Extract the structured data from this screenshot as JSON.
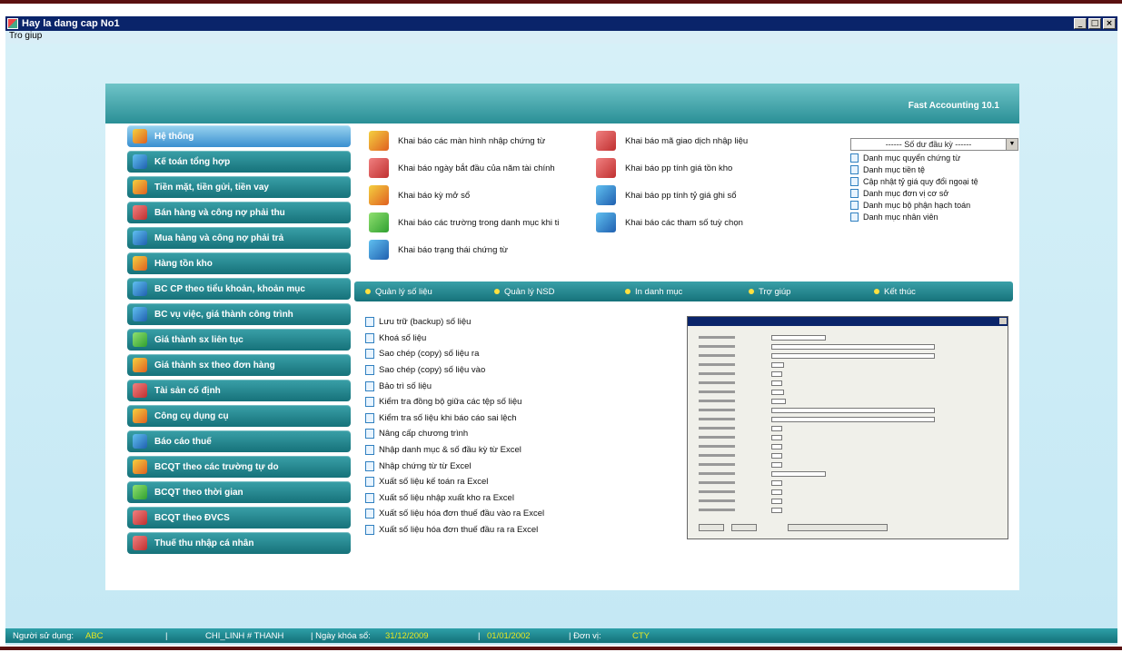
{
  "window": {
    "title": "Hay la dang cap No1",
    "menu": [
      "Tro giup"
    ],
    "controls": [
      "minimize",
      "maximize",
      "close"
    ]
  },
  "header": {
    "product": "Fast Accounting 10.1"
  },
  "nav": {
    "items": [
      {
        "label": "Hệ thống",
        "icon": "gear-icon",
        "active": true
      },
      {
        "label": "Kế toán tổng hợp",
        "icon": "ledger-icon"
      },
      {
        "label": "Tiền mặt, tiền gửi, tiền vay",
        "icon": "cash-icon"
      },
      {
        "label": "Bán hàng và công nợ phải thu",
        "icon": "sales-icon"
      },
      {
        "label": "Mua hàng và công nợ phải trả",
        "icon": "purchase-icon"
      },
      {
        "label": "Hàng tồn kho",
        "icon": "inventory-icon"
      },
      {
        "label": "BC CP theo tiểu khoản, khoản mục",
        "icon": "report-icon"
      },
      {
        "label": "BC vụ việc, giá thành công trình",
        "icon": "project-icon"
      },
      {
        "label": "Giá thành sx liên tục",
        "icon": "cost-icon"
      },
      {
        "label": "Giá thành sx theo đơn hàng",
        "icon": "order-cost-icon"
      },
      {
        "label": "Tài sản cố định",
        "icon": "asset-icon"
      },
      {
        "label": "Công cụ dụng cụ",
        "icon": "tools-icon"
      },
      {
        "label": "Báo cáo thuế",
        "icon": "tax-icon"
      },
      {
        "label": "BCQT theo các trường tự do",
        "icon": "custom-report-icon"
      },
      {
        "label": "BCQT theo thời gian",
        "icon": "time-report-icon"
      },
      {
        "label": "BCQT theo ĐVCS",
        "icon": "unit-report-icon"
      },
      {
        "label": "Thuế thu nhập cá nhân",
        "icon": "person-tax-icon"
      }
    ]
  },
  "functions": [
    {
      "label": "Khai báo các màn hình nhập chứng từ",
      "icon": "edit-form-icon"
    },
    {
      "label": "Khai báo mã giao dịch nhập liệu",
      "icon": "transaction-code-icon"
    },
    {
      "label": "Khai báo ngày bắt đầu của năm tài chính",
      "icon": "calendar-icon"
    },
    {
      "label": "Khai báo pp tính giá tồn kho",
      "icon": "stock-method-icon"
    },
    {
      "label": "Khai báo kỳ mở sổ",
      "icon": "open-period-icon"
    },
    {
      "label": "Khai báo pp tính tỷ giá ghi sổ",
      "icon": "exchange-rate-icon"
    },
    {
      "label": "Khai báo các trường trong danh mục khi ti",
      "icon": "fields-icon"
    },
    {
      "label": "Khai báo các tham số tuỳ chọn",
      "icon": "options-icon"
    },
    {
      "label": "Khai báo trạng thái chứng từ",
      "icon": "status-icon"
    }
  ],
  "right_panel": {
    "dropdown_value": "------ Số dư đầu kỳ ------",
    "items": [
      "Danh mục quyển chứng từ",
      "Danh mục tiền tệ",
      "Cập nhật tỷ giá quy đổi ngoại tệ",
      "Danh mục đơn vị cơ sở",
      "Danh mục bộ phận hạch toán",
      "Danh mục nhân viên"
    ]
  },
  "tabs": [
    "Quản lý số liệu",
    "Quản lý NSD",
    "In danh mục",
    "Trợ giúp",
    "Kết thúc"
  ],
  "list": [
    "Lưu trữ (backup) số liệu",
    "Khoá số liệu",
    "Sao chép (copy) số liệu ra",
    "Sao chép (copy) số liệu vào",
    "Bảo trì số liệu",
    "Kiểm tra đồng bộ giữa các tệp số liệu",
    "Kiểm tra số liệu khi báo cáo sai lệch",
    "Nâng cấp chương trình",
    "Nhập danh mục & số đầu kỳ từ Excel",
    "Nhập chứng từ từ Excel",
    "Xuất số liệu kế toán ra Excel",
    "Xuất số liệu nhập xuất kho ra Excel",
    "Xuất số liệu hóa đơn thuế đầu vào ra Excel",
    "Xuất số liệu hóa đơn thuế đầu ra ra Excel"
  ],
  "status": {
    "user_label": "Người sử dụng:",
    "user_value": "ABC",
    "station": "CHI_LINH # THANH",
    "lock_label": "| Ngày khóa sổ:",
    "lock_value": "31/12/2009",
    "start_value": "01/01/2002",
    "unit_label": "| Đơn vị:",
    "unit_value": "CTY"
  },
  "colors": {
    "teal": "#16727a",
    "accent_yellow": "#e8e820",
    "title_blue": "#0a246a"
  }
}
